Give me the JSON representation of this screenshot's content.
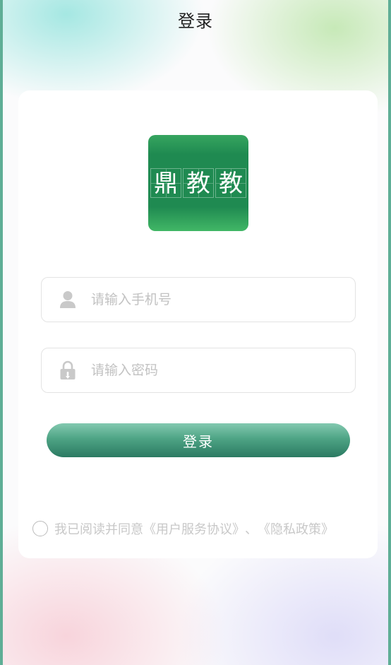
{
  "header": {
    "title": "登录"
  },
  "logo": {
    "chars": [
      "鼎",
      "教",
      "教"
    ],
    "color": "#1f8a51"
  },
  "form": {
    "phone": {
      "placeholder": "请输入手机号",
      "value": "",
      "icon": "user-icon"
    },
    "password": {
      "placeholder": "请输入密码",
      "value": "",
      "icon": "lock-icon"
    },
    "login_label": "登录"
  },
  "agreement": {
    "prefix": "我已阅读并同意",
    "service": "《用户服务协议》",
    "separator": "、",
    "privacy": "《隐私政策》",
    "checked": false
  },
  "colors": {
    "accent": "#2b7a62",
    "border": "#5fae96",
    "placeholder": "#c2c2c2"
  }
}
